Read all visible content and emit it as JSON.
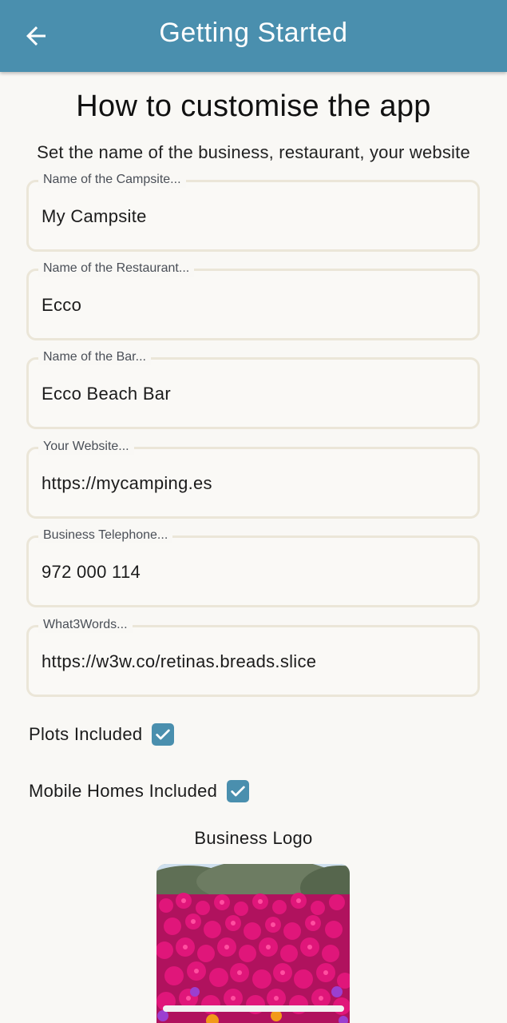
{
  "appbar": {
    "title": "Getting Started",
    "background": "#4a8fae",
    "back_icon": "arrow-left-icon"
  },
  "heading": "How to customise the app",
  "subheading": "Set the name of the business, restaurant, your website",
  "fields": [
    {
      "label": "Name of the Campsite...",
      "value": "My Campsite"
    },
    {
      "label": "Name of the Restaurant...",
      "value": "Ecco"
    },
    {
      "label": "Name of the Bar...",
      "value": "Ecco Beach Bar"
    },
    {
      "label": "Your Website...",
      "value": "https://mycamping.es"
    },
    {
      "label": "Business Telephone...",
      "value": "972 000 114"
    },
    {
      "label": "What3Words...",
      "value": "https://w3w.co/retinas.breads.slice"
    }
  ],
  "checkboxes": [
    {
      "label": "Plots Included",
      "checked": true
    },
    {
      "label": "Mobile Homes Included",
      "checked": true
    }
  ],
  "checkbox_color": "#4a8fae",
  "logo": {
    "title": "Business Logo"
  }
}
